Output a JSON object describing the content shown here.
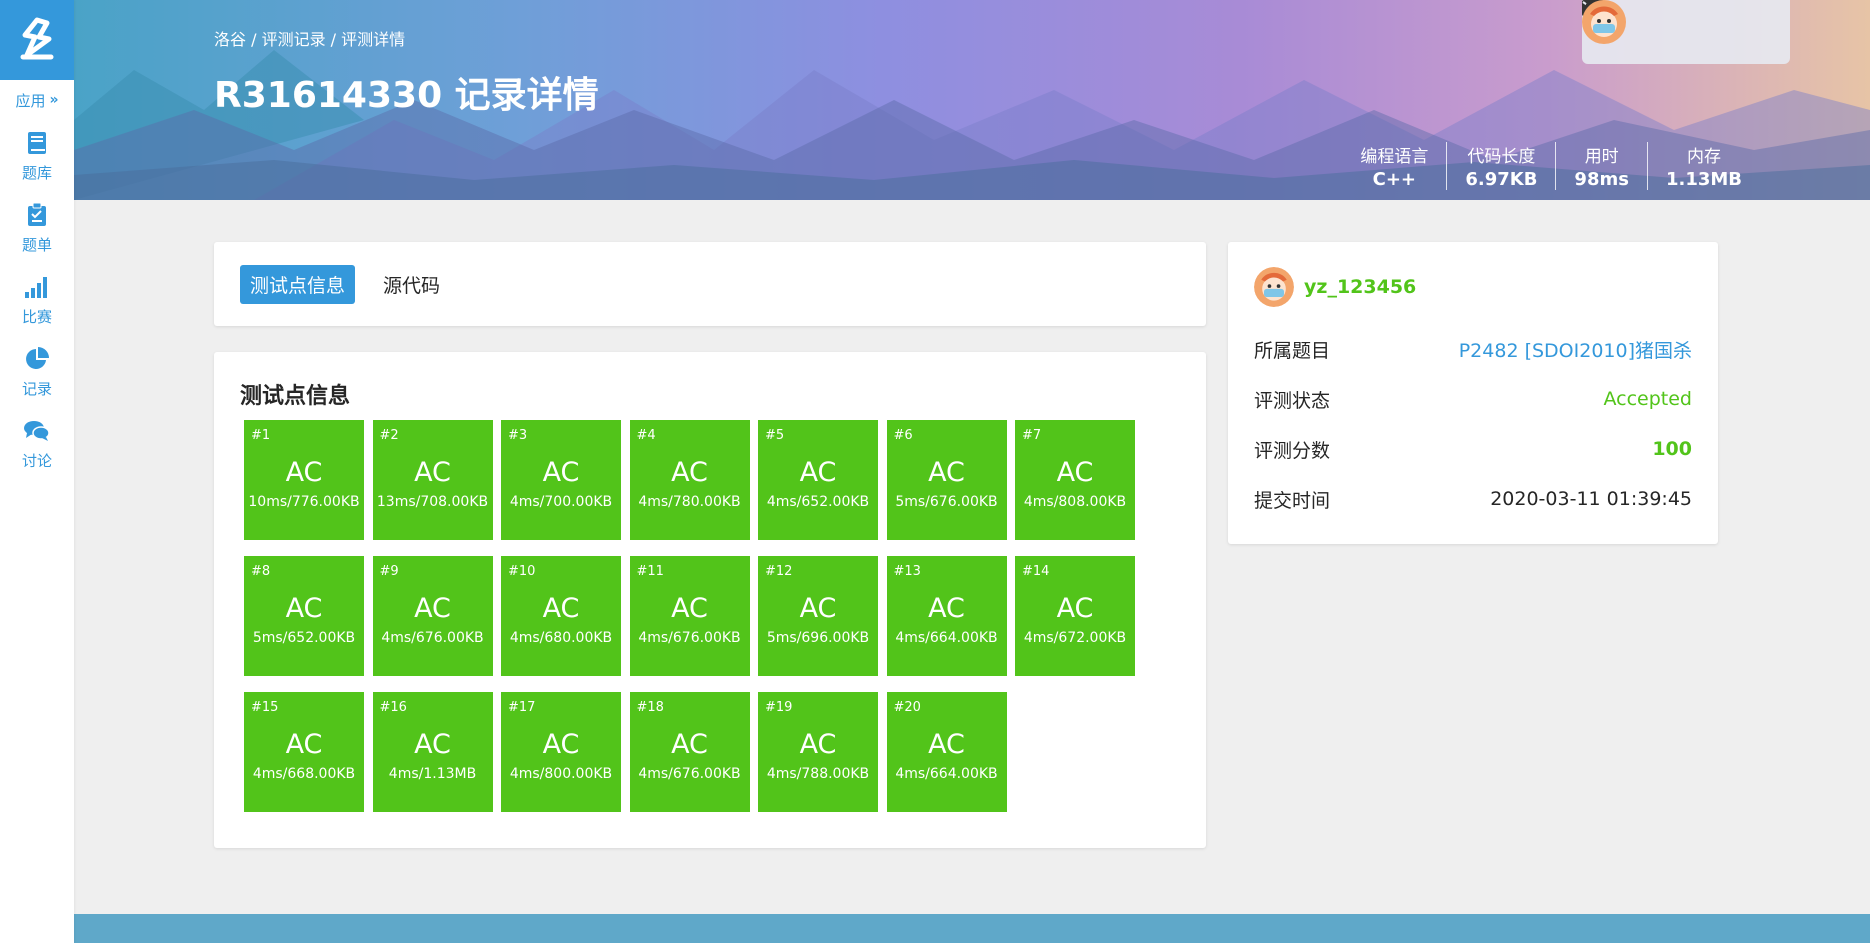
{
  "sidebar": {
    "apps_label": "应用",
    "apps_chevron": "»",
    "items": [
      {
        "label": "题库",
        "icon": "book-icon"
      },
      {
        "label": "题单",
        "icon": "clipboard-icon"
      },
      {
        "label": "比赛",
        "icon": "bar-chart-icon"
      },
      {
        "label": "记录",
        "icon": "pie-chart-icon"
      },
      {
        "label": "讨论",
        "icon": "comments-icon"
      }
    ]
  },
  "header": {
    "breadcrumb": [
      "洛谷",
      "评测记录",
      "评测详情"
    ],
    "breadcrumb_sep": " / ",
    "title": "R31614330 记录详情",
    "stats": [
      {
        "label": "编程语言",
        "value": "C++"
      },
      {
        "label": "代码长度",
        "value": "6.97KB"
      },
      {
        "label": "用时",
        "value": "98ms"
      },
      {
        "label": "内存",
        "value": "1.13MB"
      }
    ]
  },
  "tabs": [
    "测试点信息",
    "源代码"
  ],
  "cases_title": "测试点信息",
  "cases": [
    {
      "num": "#1",
      "status": "AC",
      "info": "10ms/776.00KB"
    },
    {
      "num": "#2",
      "status": "AC",
      "info": "13ms/708.00KB"
    },
    {
      "num": "#3",
      "status": "AC",
      "info": "4ms/700.00KB"
    },
    {
      "num": "#4",
      "status": "AC",
      "info": "4ms/780.00KB"
    },
    {
      "num": "#5",
      "status": "AC",
      "info": "4ms/652.00KB"
    },
    {
      "num": "#6",
      "status": "AC",
      "info": "5ms/676.00KB"
    },
    {
      "num": "#7",
      "status": "AC",
      "info": "4ms/808.00KB"
    },
    {
      "num": "#8",
      "status": "AC",
      "info": "5ms/652.00KB"
    },
    {
      "num": "#9",
      "status": "AC",
      "info": "4ms/676.00KB"
    },
    {
      "num": "#10",
      "status": "AC",
      "info": "4ms/680.00KB"
    },
    {
      "num": "#11",
      "status": "AC",
      "info": "4ms/676.00KB"
    },
    {
      "num": "#12",
      "status": "AC",
      "info": "5ms/696.00KB"
    },
    {
      "num": "#13",
      "status": "AC",
      "info": "4ms/664.00KB"
    },
    {
      "num": "#14",
      "status": "AC",
      "info": "4ms/672.00KB"
    },
    {
      "num": "#15",
      "status": "AC",
      "info": "4ms/668.00KB"
    },
    {
      "num": "#16",
      "status": "AC",
      "info": "4ms/1.13MB"
    },
    {
      "num": "#17",
      "status": "AC",
      "info": "4ms/800.00KB"
    },
    {
      "num": "#18",
      "status": "AC",
      "info": "4ms/676.00KB"
    },
    {
      "num": "#19",
      "status": "AC",
      "info": "4ms/788.00KB"
    },
    {
      "num": "#20",
      "status": "AC",
      "info": "4ms/664.00KB"
    }
  ],
  "record": {
    "user": "yz_123456",
    "rows": [
      {
        "label": "所属题目",
        "value": "P2482 [SDOI2010]猪国杀",
        "style": "link"
      },
      {
        "label": "评测状态",
        "value": "Accepted",
        "style": "green"
      },
      {
        "label": "评测分数",
        "value": "100",
        "style": "green bold"
      },
      {
        "label": "提交时间",
        "value": "2020-03-11 01:39:45",
        "style": ""
      }
    ]
  },
  "colors": {
    "accent": "#3498db",
    "accepted": "#52c41a",
    "page_bg": "#efefef"
  }
}
